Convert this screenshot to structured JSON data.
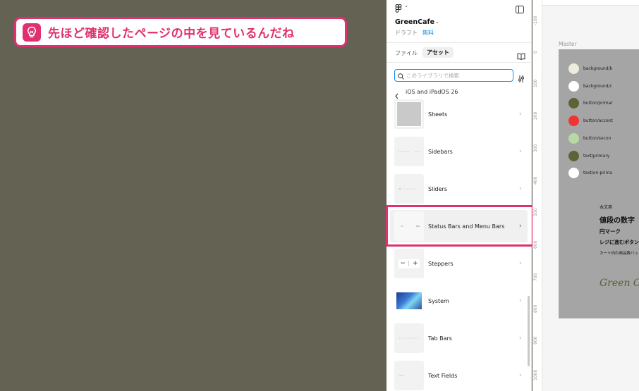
{
  "callout": {
    "text": "先ほど確認したページの中を見ているんだね"
  },
  "panel": {
    "project_name": "GreenCafe",
    "draft_label": "ドラフト",
    "plan_label": "無料",
    "tabs": [
      {
        "label": "ファイル"
      },
      {
        "label": "アセット"
      }
    ],
    "search": {
      "placeholder": "このライブラリで検索"
    },
    "breadcrumb": "iOS and iPadOS 26",
    "items": [
      {
        "label": "Sheets"
      },
      {
        "label": "Sidebars"
      },
      {
        "label": "Sliders"
      },
      {
        "label": "Status Bars and Menu Bars"
      },
      {
        "label": "Steppers"
      },
      {
        "label": "System"
      },
      {
        "label": "Tab Bars"
      },
      {
        "label": "Text Fields"
      }
    ]
  },
  "canvas": {
    "frame_label": "Master",
    "ruler_ticks": [
      "-100",
      "0",
      "100",
      "200",
      "300",
      "400",
      "500",
      "600",
      "700",
      "800",
      "900",
      "1000"
    ],
    "swatches": [
      {
        "label": "background/b",
        "color": "#eeecdf"
      },
      {
        "label": "background/c",
        "color": "#ffffff"
      },
      {
        "label": "button/primar",
        "color": "#5f6237"
      },
      {
        "label": "button/accent",
        "color": "#f03434"
      },
      {
        "label": "button/secon",
        "color": "#b8d8a4"
      },
      {
        "label": "text/primary",
        "color": "#5f6237"
      },
      {
        "label": "text/on-prima",
        "color": "#ffffff"
      }
    ],
    "typography": [
      {
        "label": "本文用"
      },
      {
        "label": "値段の数字"
      },
      {
        "label": "円マーク"
      },
      {
        "label": "レジに進むボタン"
      },
      {
        "label": "カート内の商品数バッ"
      }
    ],
    "logo_text": "Green Caf"
  },
  "colors": {
    "accent": "#e0306f",
    "selection": "#0d8ce9",
    "background": "#636253"
  }
}
